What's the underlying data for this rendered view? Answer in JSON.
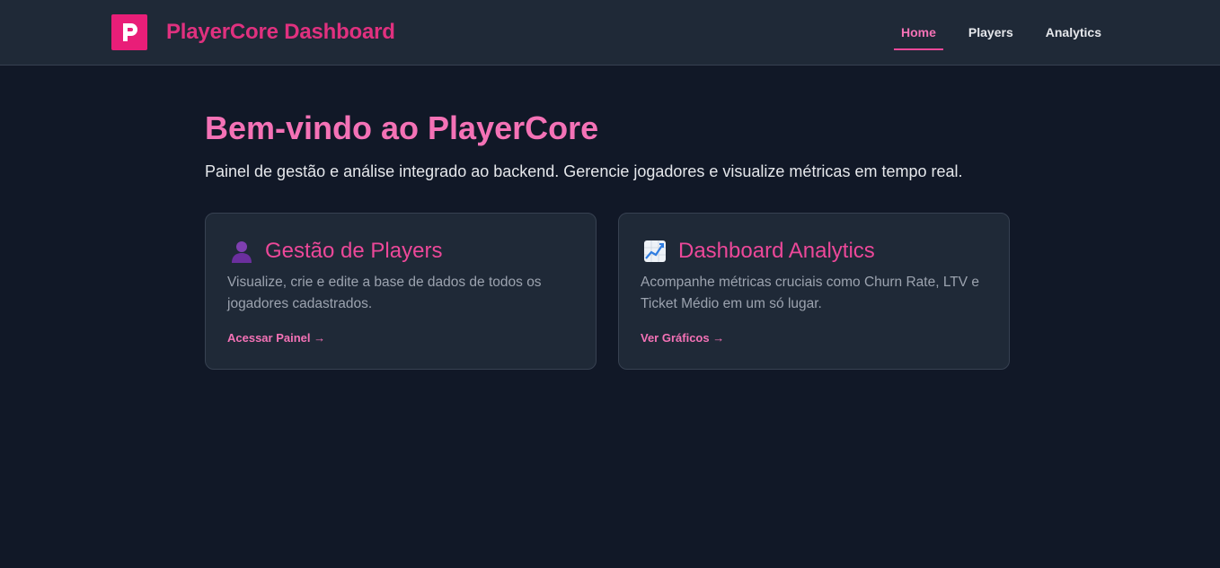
{
  "header": {
    "title": "PlayerCore Dashboard",
    "logo_letter": "P",
    "logo_color": "#e91e78",
    "nav": [
      {
        "label": "Home",
        "active": true
      },
      {
        "label": "Players",
        "active": false
      },
      {
        "label": "Analytics",
        "active": false
      }
    ]
  },
  "hero": {
    "title": "Bem-vindo ao PlayerCore",
    "subtitle": "Painel de gestão e análise integrado ao backend. Gerencie jogadores e visualize métricas em tempo real."
  },
  "cards": [
    {
      "icon": "user-silhouette-icon",
      "title": "Gestão de Players",
      "description": "Visualize, crie e edite a base de dados de todos os jogadores cadastrados.",
      "link": "Acessar Painel →"
    },
    {
      "icon": "chart-increasing-icon",
      "title": "Dashboard Analytics",
      "description": "Acompanhe métricas cruciais como Churn Rate, LTV e Ticket Médio em um só lugar.",
      "link": "Ver Gráficos →"
    }
  ],
  "colors": {
    "background": "#111827",
    "surface": "#1f2937",
    "accent": "#ec4899",
    "accent_light": "#f472b6"
  }
}
